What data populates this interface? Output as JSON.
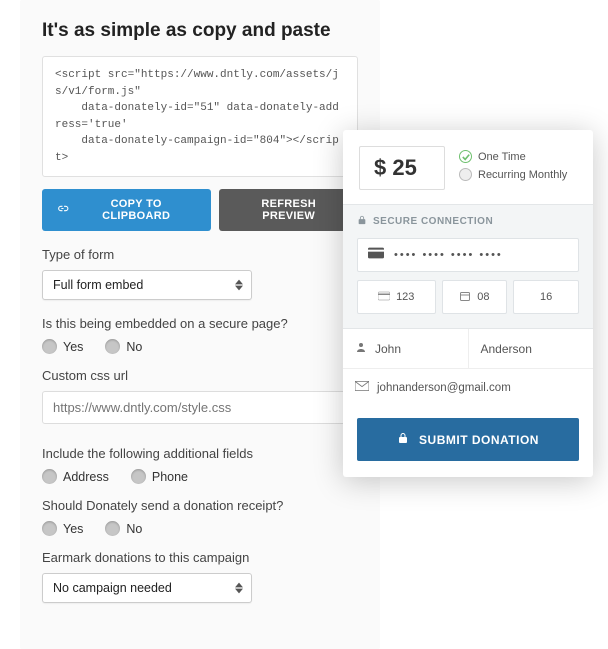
{
  "config": {
    "title": "It's as simple as copy and paste",
    "code": "<script src=\"https://www.dntly.com/assets/js/v1/form.js\"\n    data-donately-id=\"51\" data-donately-address='true'\n    data-donately-campaign-id=\"804\"></script>",
    "copy_btn": "COPY TO CLIPBOARD",
    "refresh_btn": "REFRESH PREVIEW",
    "type_label": "Type of form",
    "type_value": "Full form embed",
    "secure_q": "Is this being embedded on a secure page?",
    "opt_yes": "Yes",
    "opt_no": "No",
    "css_label": "Custom css url",
    "css_placeholder": "https://www.dntly.com/style.css",
    "include_label": "Include the following additional fields",
    "opt_address": "Address",
    "opt_phone": "Phone",
    "receipt_q": "Should Donately send a donation receipt?",
    "earmark_label": "Earmark donations to this campaign",
    "earmark_value": "No campaign needed"
  },
  "donate": {
    "amount": "$ 25",
    "freq_one": "One Time",
    "freq_rec": "Recurring Monthly",
    "secure": "SECURE CONNECTION",
    "cc_dots": "•••• •••• •••• ••••",
    "cvc": "123",
    "mm": "08",
    "yy": "16",
    "first": "John",
    "last": "Anderson",
    "email": "johnanderson@gmail.com",
    "submit": "SUBMIT DONATION"
  }
}
